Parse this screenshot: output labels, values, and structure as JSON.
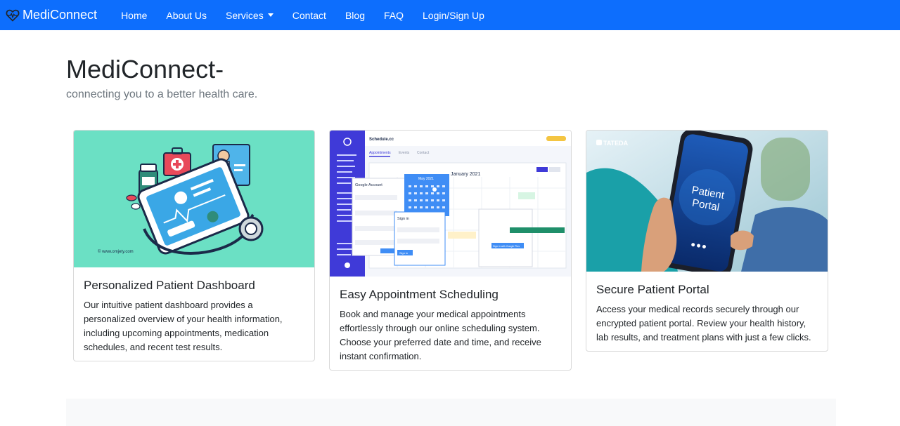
{
  "nav": {
    "brand": "MediConnect",
    "links": [
      "Home",
      "About Us",
      "Services",
      "Contact",
      "Blog",
      "FAQ",
      "Login/Sign Up"
    ]
  },
  "hero": {
    "title": "MediConnect-",
    "subtitle": "connecting you to a better health care."
  },
  "cards": [
    {
      "title": "Personalized Patient Dashboard",
      "text": "Our intuitive patient dashboard provides a personalized overview of your health information, including upcoming appointments, medication schedules, and recent test results.",
      "image_caption": "© www.omjety.com"
    },
    {
      "title": "Easy Appointment Scheduling",
      "text": "Book and manage your medical appointments effortlessly through our online scheduling system. Choose your preferred date and time, and receive instant confirmation.",
      "image_labels": {
        "app_name": "Schedule.cc",
        "tab1": "Appointments",
        "tab2": "Events",
        "tab3": "Contact",
        "calendar_month": "January 2021",
        "popup_month": "May 2021",
        "google_title": "Google Account",
        "signin_title": "Sign in",
        "signin_button": "Sign in",
        "google_button": "Sign in with Google Plus"
      }
    },
    {
      "title": "Secure Patient Portal",
      "text": "Access your medical records securely through our encrypted patient portal. Review your health history, lab results, and treatment plans with just a few clicks.",
      "image_labels": {
        "logo": "TATEDA",
        "screen_line1": "Patient",
        "screen_line2": "Portal"
      }
    }
  ],
  "colors": {
    "primary": "#0d6efd",
    "card1_bg": "#6be0c4",
    "footer_band": "#f8f9fa"
  }
}
